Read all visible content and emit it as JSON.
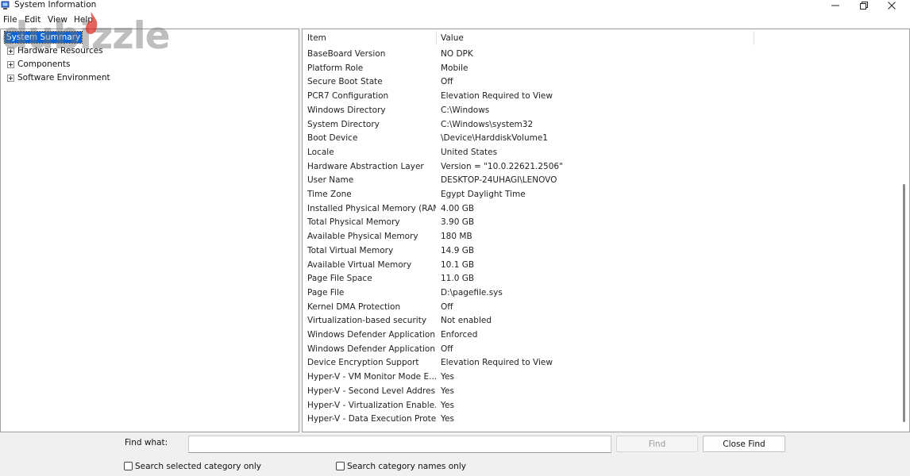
{
  "window": {
    "title": "System Information",
    "app_icon": "system-information-icon",
    "controls": [
      "minimize-icon",
      "maximize-icon",
      "close-icon"
    ]
  },
  "watermark": {
    "text": "dubizzle"
  },
  "menu": {
    "items": [
      {
        "label": "File"
      },
      {
        "label": "Edit"
      },
      {
        "label": "View"
      },
      {
        "label": "Help"
      }
    ]
  },
  "tree": {
    "items": [
      {
        "label": "System Summary",
        "selected": true,
        "expandable": false
      },
      {
        "label": "Hardware Resources",
        "selected": false,
        "expandable": true
      },
      {
        "label": "Components",
        "selected": false,
        "expandable": true
      },
      {
        "label": "Software Environment",
        "selected": false,
        "expandable": true
      }
    ]
  },
  "table": {
    "columns": [
      "Item",
      "Value"
    ],
    "rows": [
      [
        "BaseBoard Version",
        "NO DPK"
      ],
      [
        "Platform Role",
        "Mobile"
      ],
      [
        "Secure Boot State",
        "Off"
      ],
      [
        "PCR7 Configuration",
        "Elevation Required to View"
      ],
      [
        "Windows Directory",
        "C:\\Windows"
      ],
      [
        "System Directory",
        "C:\\Windows\\system32"
      ],
      [
        "Boot Device",
        "\\Device\\HarddiskVolume1"
      ],
      [
        "Locale",
        "United States"
      ],
      [
        "Hardware Abstraction Layer",
        "Version = \"10.0.22621.2506\""
      ],
      [
        "User Name",
        "DESKTOP-24UHAGI\\LENOVO"
      ],
      [
        "Time Zone",
        "Egypt Daylight Time"
      ],
      [
        "Installed Physical Memory (RAM)",
        "4.00 GB"
      ],
      [
        "Total Physical Memory",
        "3.90 GB"
      ],
      [
        "Available Physical Memory",
        "180 MB"
      ],
      [
        "Total Virtual Memory",
        "14.9 GB"
      ],
      [
        "Available Virtual Memory",
        "10.1 GB"
      ],
      [
        "Page File Space",
        "11.0 GB"
      ],
      [
        "Page File",
        "D:\\pagefile.sys"
      ],
      [
        "Kernel DMA Protection",
        "Off"
      ],
      [
        "Virtualization-based security",
        "Not enabled"
      ],
      [
        "Windows Defender Application...",
        "Enforced"
      ],
      [
        "Windows Defender Application...",
        "Off"
      ],
      [
        "Device Encryption Support",
        "Elevation Required to View"
      ],
      [
        "Hyper-V - VM Monitor Mode E...",
        "Yes"
      ],
      [
        "Hyper-V - Second Level Addres...",
        "Yes"
      ],
      [
        "Hyper-V - Virtualization Enable...",
        "Yes"
      ],
      [
        "Hyper-V - Data Execution Prote...",
        "Yes"
      ]
    ]
  },
  "find_bar": {
    "label": "Find what:",
    "value": "",
    "find_button": "Find",
    "close_find_button": "Close Find",
    "search_selected_label": "Search selected category only",
    "search_selected_checked": false,
    "search_names_label": "Search category names only",
    "search_names_checked": false
  }
}
